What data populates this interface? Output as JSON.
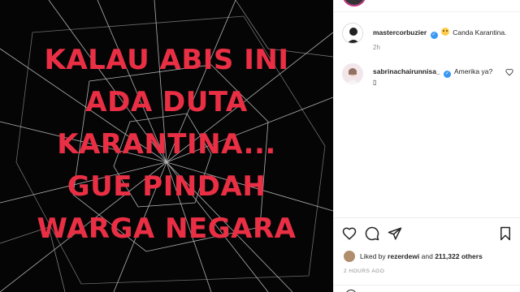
{
  "media": {
    "caption_lines": [
      "KALAU ABIS INI",
      "ADA DUTA",
      "KARANTINA...",
      "GUE PINDAH",
      "WARGA NEGARA"
    ]
  },
  "comments": [
    {
      "username": "mastercorbuzier",
      "verified_icon": "verified-badge",
      "text": "Canda Karantina.",
      "emoji": "laughing-emoji",
      "time": "2h"
    },
    {
      "username": "sabrinachairunnisa_",
      "verified_icon": "verified-badge",
      "text": "Amerika ya?",
      "extra": "▯"
    }
  ],
  "post": {
    "liked_prefix": "Liked by",
    "liked_user": "rezerdewi",
    "liked_and": "and",
    "liked_count": "211,322 others",
    "time_ago": "2 HOURS AGO"
  },
  "colors": {
    "caption_red": "#ea2f45",
    "verified_blue": "#3897f0",
    "media_bg": "#050505"
  },
  "icons": [
    "heart-icon",
    "comment-icon",
    "share-icon",
    "bookmark-icon",
    "emoji-icon"
  ]
}
